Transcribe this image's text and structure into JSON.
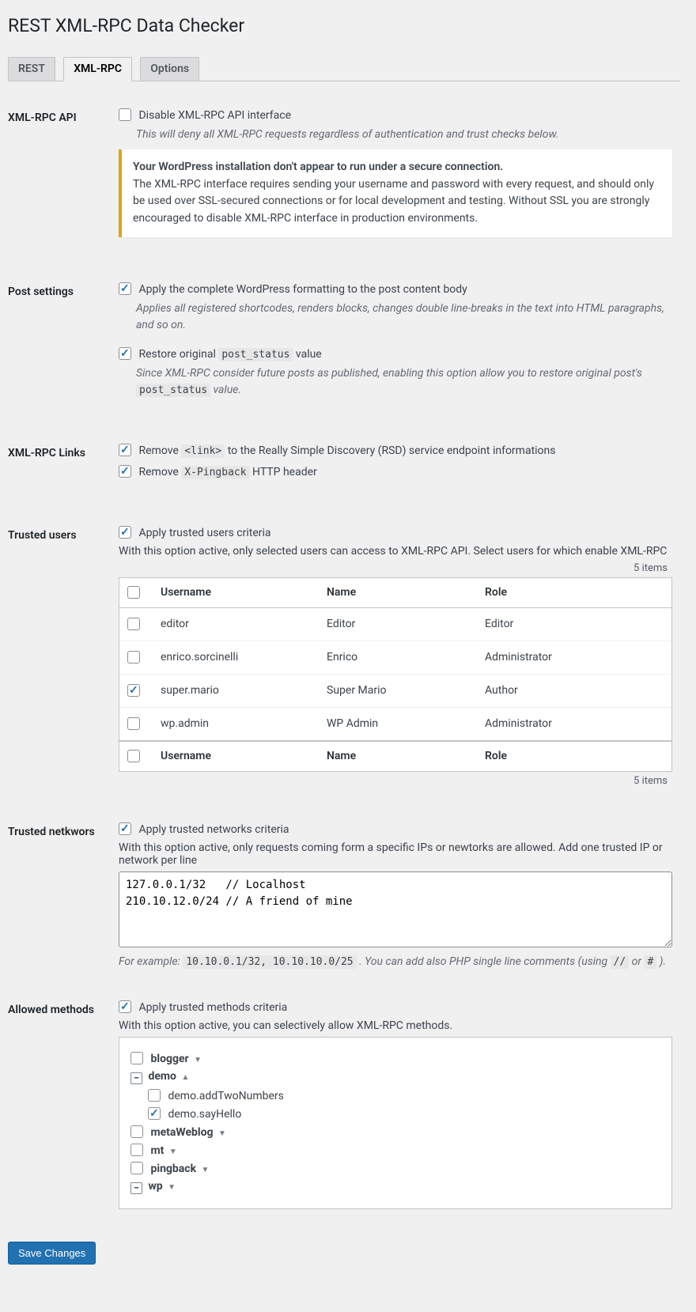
{
  "page_title": "REST XML-RPC Data Checker",
  "tabs": [
    {
      "label": "REST",
      "active": false
    },
    {
      "label": "XML-RPC",
      "active": true
    },
    {
      "label": "Options",
      "active": false
    }
  ],
  "sections": {
    "xmlrpc_api": {
      "heading": "XML-RPC API",
      "disable_label": "Disable XML-RPC API interface",
      "disable_desc": "This will deny all XML-RPC requests regardless of authentication and trust checks below.",
      "warning_strong": "Your WordPress installation don't appear to run under a secure connection.",
      "warning_body": "The XML-RPC interface requires sending your username and password with every request, and should only be used over SSL-secured connections or for local development and testing. Without SSL you are strongly encouraged to disable XML-RPC interface in production environments."
    },
    "post_settings": {
      "heading": "Post settings",
      "format_label": "Apply the complete WordPress formatting to the post content body",
      "format_desc": "Applies all registered shortcodes, renders blocks, changes double line-breaks in the text into HTML paragraphs, and so on.",
      "restore_label_pre": "Restore original ",
      "restore_code1": "post_status",
      "restore_label_post": " value",
      "restore_desc_pre": "Since XML-RPC consider future posts as published, enabling this option allow you to restore original post's ",
      "restore_desc_code": "post_status",
      "restore_desc_post": " value."
    },
    "links": {
      "heading": "XML-RPC Links",
      "rsd_pre": "Remove ",
      "rsd_code": "<link>",
      "rsd_post": " to the Really Simple Discovery (RSD) service endpoint informations",
      "ping_pre": "Remove ",
      "ping_code": "X-Pingback",
      "ping_post": " HTTP header"
    },
    "trusted_users": {
      "heading": "Trusted users",
      "apply_label": "Apply trusted users criteria",
      "sub": "With this option active, only selected users can access to XML-RPC API. Select users for which enable XML-RPC",
      "items_label": "5 items",
      "columns": {
        "user": "Username",
        "name": "Name",
        "role": "Role"
      },
      "rows": [
        {
          "user": "editor",
          "name": "Editor",
          "role": "Editor",
          "checked": false
        },
        {
          "user": "enrico.sorcinelli",
          "name": "Enrico",
          "role": "Administrator",
          "checked": false
        },
        {
          "user": "super.mario",
          "name": "Super Mario",
          "role": "Author",
          "checked": true
        },
        {
          "user": "wp.admin",
          "name": "WP Admin",
          "role": "Administrator",
          "checked": false
        }
      ]
    },
    "trusted_networks": {
      "heading": "Trusted netkwors",
      "apply_label": "Apply trusted networks criteria",
      "sub": "With this option active, only requests coming form a specific IPs or newtorks are allowed. Add one trusted IP or network per line",
      "value": "127.0.0.1/32   // Localhost\n210.10.12.0/24 // A friend of mine",
      "example_pre": "For example: ",
      "example_code": "10.10.0.1/32, 10.10.10.0/25",
      "example_mid": " . You can add also PHP single line comments (using ",
      "example_c1": "//",
      "example_or": " or ",
      "example_c2": "#",
      "example_end": " )."
    },
    "allowed_methods": {
      "heading": "Allowed methods",
      "apply_label": "Apply trusted methods criteria",
      "sub": "With this option active, you can selectively allow XML-RPC methods.",
      "tree": [
        {
          "kind": "cb",
          "label": "blogger",
          "caret": "down"
        },
        {
          "kind": "toggle",
          "label": "demo",
          "caret": "up",
          "open": true,
          "children": [
            {
              "label": "demo.addTwoNumbers",
              "checked": false
            },
            {
              "label": "demo.sayHello",
              "checked": true
            }
          ]
        },
        {
          "kind": "cb",
          "label": "metaWeblog",
          "caret": "down"
        },
        {
          "kind": "cb",
          "label": "mt",
          "caret": "down"
        },
        {
          "kind": "cb",
          "label": "pingback",
          "caret": "down"
        },
        {
          "kind": "toggle",
          "label": "wp",
          "caret": "down",
          "open": false
        }
      ]
    }
  },
  "save_button": "Save Changes"
}
